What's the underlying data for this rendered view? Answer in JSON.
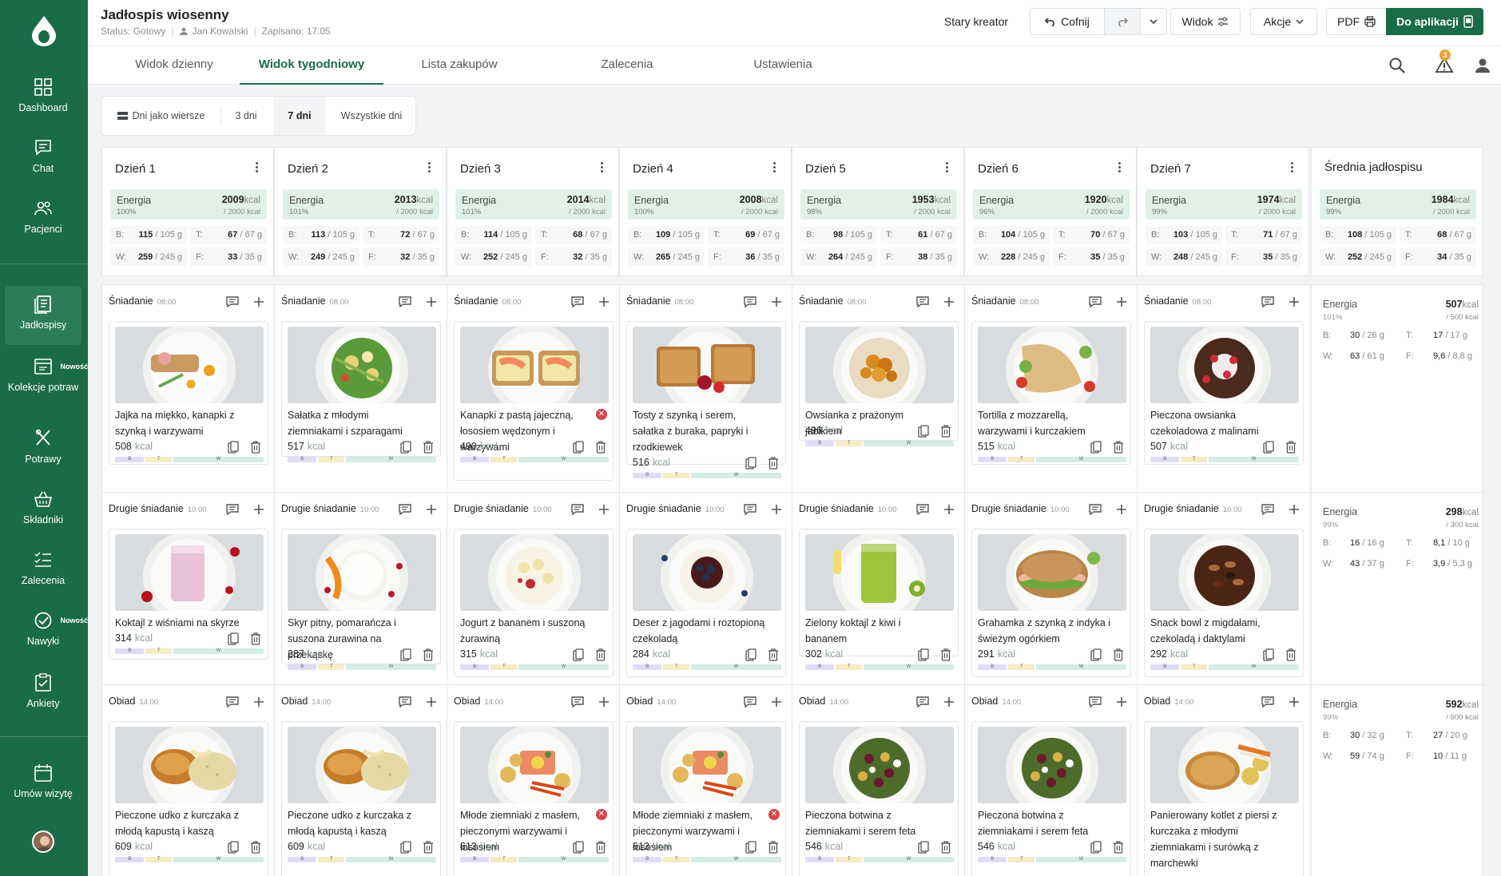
{
  "sidebar": {
    "items": [
      {
        "label": "Dashboard",
        "icon": "dashboard-icon"
      },
      {
        "label": "Chat",
        "icon": "chat-icon"
      },
      {
        "label": "Pacjenci",
        "icon": "patients-icon"
      },
      {
        "label": "Jadłospisy",
        "icon": "meal-plans-icon",
        "active": true
      },
      {
        "label": "Kolekcje potraw",
        "icon": "collections-icon",
        "badge": "Nowość"
      },
      {
        "label": "Potrawy",
        "icon": "cutlery-icon"
      },
      {
        "label": "Składniki",
        "icon": "basket-icon"
      },
      {
        "label": "Zalecenia",
        "icon": "checklist-icon"
      },
      {
        "label": "Nawyki",
        "icon": "habits-icon",
        "badge": "Nowość"
      },
      {
        "label": "Ankiety",
        "icon": "survey-icon"
      },
      {
        "label": "Umów wizytę",
        "icon": "calendar-icon"
      }
    ]
  },
  "header": {
    "title": "Jadłospis wiosenny",
    "status": "Status: Gotowy",
    "author": "Jan Kowalski",
    "saved": "Zapisano: 17:05",
    "old_creator": "Stary kreator",
    "undo": "Cofnij",
    "view": "Widok",
    "actions": "Akcje",
    "pdf": "PDF",
    "to_app": "Do aplikacji",
    "alert_count": "3"
  },
  "tabs": [
    "Widok dzienny",
    "Widok tygodniowy",
    "Lista zakupów",
    "Zalecenia",
    "Ustawienia"
  ],
  "segments": {
    "rows_label": "Dni jako wiersze",
    "options": [
      "3 dni",
      "7 dni",
      "Wszystkie dni"
    ],
    "selected": "7 dni"
  },
  "labels": {
    "energy": "Energia",
    "kcal": "kcal",
    "b": "B:",
    "t": "T:",
    "w": "W:",
    "f": "F:",
    "bar_b": "B",
    "bar_t": "T",
    "bar_w": "W"
  },
  "days": [
    {
      "name": "Dzień 1",
      "kcal": "2009",
      "pct": "100%",
      "target": "/ 2000 kcal",
      "b": "115",
      "bt": "/ 105 g",
      "t": "67",
      "tt": "/ 67 g",
      "w": "259",
      "wt": "/ 245 g",
      "f": "33",
      "ft": "/ 35 g"
    },
    {
      "name": "Dzień 2",
      "kcal": "2013",
      "pct": "101%",
      "target": "/ 2000 kcal",
      "b": "113",
      "bt": "/ 105 g",
      "t": "72",
      "tt": "/ 67 g",
      "w": "249",
      "wt": "/ 245 g",
      "f": "32",
      "ft": "/ 35 g"
    },
    {
      "name": "Dzień 3",
      "kcal": "2014",
      "pct": "101%",
      "target": "/ 2000 kcal",
      "b": "114",
      "bt": "/ 105 g",
      "t": "68",
      "tt": "/ 67 g",
      "w": "252",
      "wt": "/ 245 g",
      "f": "32",
      "ft": "/ 35 g"
    },
    {
      "name": "Dzień 4",
      "kcal": "2008",
      "pct": "100%",
      "target": "/ 2000 kcal",
      "b": "109",
      "bt": "/ 105 g",
      "t": "69",
      "tt": "/ 67 g",
      "w": "265",
      "wt": "/ 245 g",
      "f": "36",
      "ft": "/ 35 g"
    },
    {
      "name": "Dzień 5",
      "kcal": "1953",
      "pct": "98%",
      "target": "/ 2000 kcal",
      "b": "98",
      "bt": "/ 105 g",
      "t": "61",
      "tt": "/ 67 g",
      "w": "264",
      "wt": "/ 245 g",
      "f": "38",
      "ft": "/ 35 g"
    },
    {
      "name": "Dzień 6",
      "kcal": "1920",
      "pct": "96%",
      "target": "/ 2000 kcal",
      "b": "104",
      "bt": "/ 105 g",
      "t": "70",
      "tt": "/ 67 g",
      "w": "228",
      "wt": "/ 245 g",
      "f": "35",
      "ft": "/ 35 g"
    },
    {
      "name": "Dzień 7",
      "kcal": "1974",
      "pct": "99%",
      "target": "/ 2000 kcal",
      "b": "103",
      "bt": "/ 105 g",
      "t": "71",
      "tt": "/ 67 g",
      "w": "248",
      "wt": "/ 245 g",
      "f": "35",
      "ft": "/ 35 g"
    }
  ],
  "average": {
    "name": "Średnia jadłospisu",
    "kcal": "1984",
    "pct": "99%",
    "target": "/ 2000 kcal",
    "b": "108",
    "bt": "/ 105 g",
    "t": "68",
    "tt": "/ 67 g",
    "w": "252",
    "wt": "/ 245 g",
    "f": "34",
    "ft": "/ 35 g"
  },
  "meal_slots": [
    {
      "name": "Śniadanie",
      "time": "08:00"
    },
    {
      "name": "Drugie śniadanie",
      "time": "10:00"
    },
    {
      "name": "Obiad",
      "time": "14:00"
    }
  ],
  "meals": [
    [
      {
        "name": "Jajka na miękko, kanapki z szynką i warzywami",
        "kcal": "508",
        "photo": "eggs"
      },
      {
        "name": "Koktajl z wiśniami na skyrze",
        "kcal": "314",
        "photo": "smoothie-pink"
      },
      {
        "name": "Pieczone udko z kurczaka z młodą kapustą i kaszą",
        "kcal": "609",
        "photo": "chicken"
      }
    ],
    [
      {
        "name": "Sałatka z młodymi ziemniakami i szparagami",
        "kcal": "517",
        "photo": "salad"
      },
      {
        "name": "Skyr pitny, pomarańcza i suszona żurawina na przekąskę",
        "kcal": "287",
        "photo": "skyr"
      },
      {
        "name": "Pieczone udko z kurczaka z młodą kapustą i kaszą",
        "kcal": "609",
        "photo": "chicken"
      }
    ],
    [
      {
        "name": "Kanapki z pastą jajeczną, łososiem wędzonym i warzywami",
        "kcal": "490",
        "photo": "salmon-toast",
        "warn": true
      },
      {
        "name": "Jogurt z bananem i suszoną żurawiną",
        "kcal": "315",
        "photo": "yogurt"
      },
      {
        "name": "Młode ziemniaki z masłem, pieczonymi warzywami i łososiem",
        "kcal": "613",
        "photo": "salmon-potatoes",
        "warn": true
      }
    ],
    [
      {
        "name": "Tosty z szynką i serem, sałatka z buraka, papryki i rzodkiewek",
        "kcal": "516",
        "photo": "toast"
      },
      {
        "name": "Deser z jagodami i roztopioną czekoladą",
        "kcal": "284",
        "photo": "berries"
      },
      {
        "name": "Młode ziemniaki z masłem, pieczonymi warzywami i łososiem",
        "kcal": "613",
        "photo": "salmon-potatoes",
        "warn": true
      }
    ],
    [
      {
        "name": "Owsianka z prażonym jabłkiem",
        "kcal": "496",
        "photo": "oatmeal"
      },
      {
        "name": "Zielony koktajl z kiwi i bananem",
        "kcal": "302",
        "photo": "smoothie-green"
      },
      {
        "name": "Pieczona botwina z ziemniakami i serem feta",
        "kcal": "546",
        "photo": "beet"
      }
    ],
    [
      {
        "name": "Tortilla z mozzarellą, warzywami i kurczakiem",
        "kcal": "515",
        "photo": "tortilla"
      },
      {
        "name": "Grahamka z szynką z indyka i świeżym ogórkiem",
        "kcal": "291",
        "photo": "sandwich"
      },
      {
        "name": "Pieczona botwina z ziemniakami i serem feta",
        "kcal": "546",
        "photo": "beet"
      }
    ],
    [
      {
        "name": "Pieczona owsianka czekoladowa z malinami",
        "kcal": "507",
        "photo": "choc-oats"
      },
      {
        "name": "Snack bowl z migdałami, czekoladą i daktylami",
        "kcal": "292",
        "photo": "nuts"
      },
      {
        "name": "Panierowany kotlet z piersi z kurczaka z młodymi ziemniakami i surówką z marchewki",
        "kcal": "",
        "photo": "cutlet"
      }
    ]
  ],
  "avg_meals": [
    {
      "kcal": "507",
      "pct": "101%",
      "target": "/ 500 kcal",
      "b": "30",
      "bt": "/ 26 g",
      "t": "17",
      "tt": "/ 17 g",
      "w": "63",
      "wt": "/ 61 g",
      "f": "9,6",
      "ft": "/ 8,8 g"
    },
    {
      "kcal": "298",
      "pct": "99%",
      "target": "/ 300 kcal",
      "b": "16",
      "bt": "/ 16 g",
      "t": "8,1",
      "tt": "/ 10 g",
      "w": "43",
      "wt": "/ 37 g",
      "f": "3,9",
      "ft": "/ 5,3 g"
    },
    {
      "kcal": "592",
      "pct": "99%",
      "target": "/ 600 kcal",
      "b": "30",
      "bt": "/ 32 g",
      "t": "27",
      "tt": "/ 20 g",
      "w": "59",
      "wt": "/ 74 g",
      "f": "10",
      "ft": "/ 11 g"
    }
  ]
}
